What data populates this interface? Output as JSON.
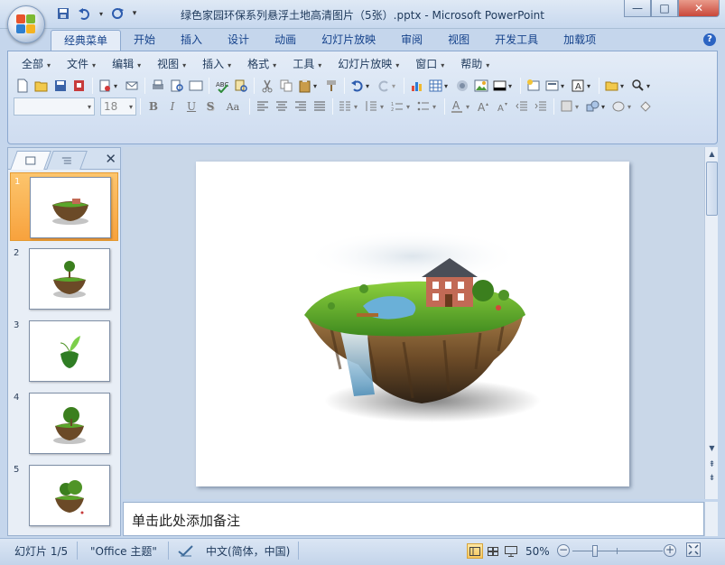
{
  "window": {
    "title": "绿色家园环保系列悬浮土地高清图片（5张）.pptx - Microsoft PowerPoint",
    "controls": {
      "minimize": "—",
      "maximize": "□",
      "close": "✕"
    }
  },
  "ribbon": {
    "tabs": [
      {
        "label": "经典菜单",
        "active": true
      },
      {
        "label": "开始"
      },
      {
        "label": "插入"
      },
      {
        "label": "设计"
      },
      {
        "label": "动画"
      },
      {
        "label": "幻灯片放映"
      },
      {
        "label": "审阅"
      },
      {
        "label": "视图"
      },
      {
        "label": "开发工具"
      },
      {
        "label": "加载项"
      }
    ],
    "help_label": "?",
    "menus": [
      {
        "label": "全部"
      },
      {
        "label": "文件"
      },
      {
        "label": "编辑"
      },
      {
        "label": "视图"
      },
      {
        "label": "插入"
      },
      {
        "label": "格式"
      },
      {
        "label": "工具"
      },
      {
        "label": "幻灯片放映"
      },
      {
        "label": "窗口"
      },
      {
        "label": "帮助"
      }
    ],
    "font_name": "",
    "font_size": "18",
    "format_labels": {
      "bold": "B",
      "italic": "I",
      "underline": "U",
      "shadow": "S",
      "change_case": "Aa",
      "font_color": "A"
    }
  },
  "slides_pane": {
    "tab_slides": "slides",
    "tab_outline": "outline",
    "close_label": "✕",
    "slides": [
      {
        "number": "1",
        "selected": true,
        "motif": "island-house"
      },
      {
        "number": "2",
        "motif": "island-tree-small"
      },
      {
        "number": "3",
        "motif": "sprout-island"
      },
      {
        "number": "4",
        "motif": "island-tree"
      },
      {
        "number": "5",
        "motif": "island-trees"
      }
    ]
  },
  "notes": {
    "placeholder": "单击此处添加备注"
  },
  "status": {
    "slide_position": "幻灯片 1/5",
    "theme": "\"Office 主题\"",
    "language": "中文(简体，中国)",
    "zoom": "50%",
    "zoom_fraction": 0.5,
    "zoom_out": "−",
    "zoom_in": "+"
  },
  "colors": {
    "accent_blue": "#15428b",
    "ribbon_bg": "#d6e3f3",
    "selected_slide": "#f8a23d",
    "grass": "#5aa62b"
  }
}
